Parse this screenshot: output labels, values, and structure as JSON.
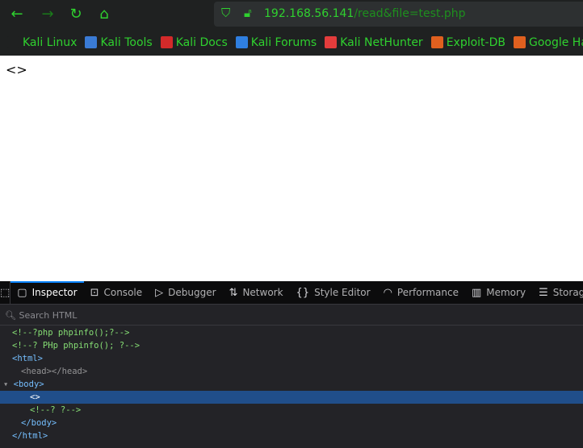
{
  "nav": {
    "back": "←",
    "forward": "→",
    "reload": "↻",
    "home": "⌂",
    "url_host": "192.168.56.141",
    "url_path": "/read&file=test.php"
  },
  "bookmarks": [
    {
      "label": "Kali Linux",
      "color": "#1f2121"
    },
    {
      "label": "Kali Tools",
      "color": "#3a7bd5"
    },
    {
      "label": "Kali Docs",
      "color": "#d32a2a"
    },
    {
      "label": "Kali Forums",
      "color": "#2f7fe0"
    },
    {
      "label": "Kali NetHunter",
      "color": "#e33c3c"
    },
    {
      "label": "Exploit-DB",
      "color": "#e0601f"
    },
    {
      "label": "Google Hacking DB",
      "color": "#e0601f"
    }
  ],
  "page": {
    "text": "<>"
  },
  "devtools": {
    "tabs": [
      {
        "label": "Inspector",
        "icon": "▢",
        "active": true
      },
      {
        "label": "Console",
        "icon": "⊡"
      },
      {
        "label": "Debugger",
        "icon": "▷"
      },
      {
        "label": "Network",
        "icon": "⇅"
      },
      {
        "label": "Style Editor",
        "icon": "{}"
      },
      {
        "label": "Performance",
        "icon": "◠"
      },
      {
        "label": "Memory",
        "icon": "▥"
      },
      {
        "label": "Storage",
        "icon": "☰"
      }
    ],
    "search_placeholder": "Search HTML",
    "tree": [
      "<!--?php phpinfo();?-->",
      "<!--? PHp phpinfo(); ?-->",
      "<html>",
      "<head></head>",
      "<body>",
      "<>",
      "<!--? ?-->",
      "</body>",
      "</html>"
    ]
  }
}
